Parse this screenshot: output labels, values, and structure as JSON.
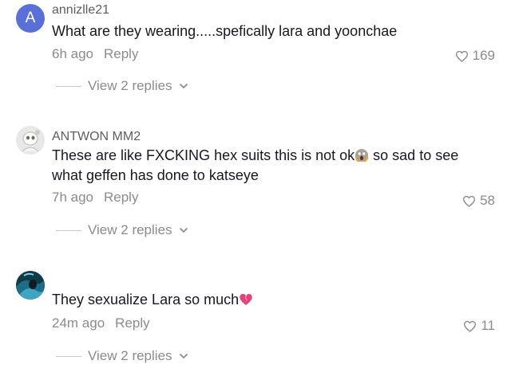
{
  "comments": [
    {
      "username": "annizlle21",
      "avatar_letter": "A",
      "text": "What are they wearing.....spefically lara and yoonchae",
      "time": "6h ago",
      "reply_label": "Reply",
      "likes": "169",
      "view_replies": "View 2 replies"
    },
    {
      "username": "ANTWON MM2",
      "text_part1": "These are like FXCKING hex suits this is not ok",
      "text_part2": " so sad to see what geffen has done to katseye",
      "time": "7h ago",
      "reply_label": "Reply",
      "likes": "58",
      "view_replies": "View 2 replies"
    },
    {
      "username": "",
      "text": "They sexualize Lara so much",
      "time": "24m ago",
      "reply_label": "Reply",
      "likes": "11",
      "view_replies": "View 2 replies"
    }
  ],
  "colors": {
    "avatar_letter_bg": "#5a6fd8",
    "text": "#161823",
    "muted": "#8a8b91"
  }
}
